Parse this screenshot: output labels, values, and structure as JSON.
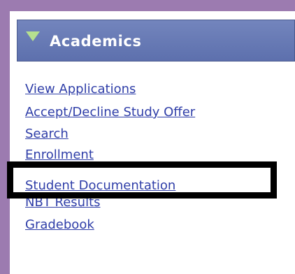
{
  "section": {
    "title": "Academics",
    "icon": "triangle-expanded-icon"
  },
  "links": [
    {
      "label": "View Applications"
    },
    {
      "label": "Accept/Decline Study Offer"
    },
    {
      "label": "Search"
    },
    {
      "label": "Enrollment"
    },
    {
      "label": "Student Documentation"
    },
    {
      "label": "NBT Results"
    },
    {
      "label": "Gradebook"
    }
  ],
  "colors": {
    "frame": "#9c7bb0",
    "header_bg": "#6a7db8",
    "link": "#2f3ea8",
    "highlight_border": "#000000"
  }
}
